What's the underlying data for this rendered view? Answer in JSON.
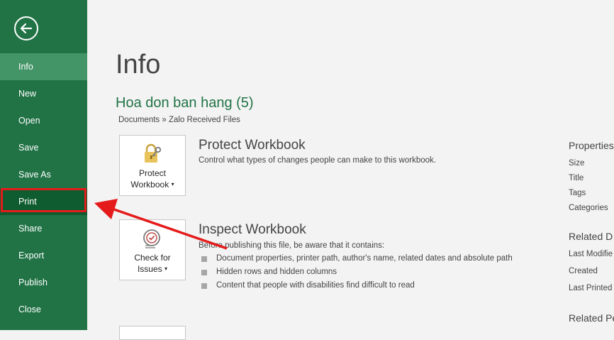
{
  "sidebar": {
    "items": [
      {
        "label": "Info"
      },
      {
        "label": "New"
      },
      {
        "label": "Open"
      },
      {
        "label": "Save"
      },
      {
        "label": "Save As"
      },
      {
        "label": "Print"
      },
      {
        "label": "Share"
      },
      {
        "label": "Export"
      },
      {
        "label": "Publish"
      },
      {
        "label": "Close"
      }
    ]
  },
  "main": {
    "title": "Info",
    "file_name": "Hoa don ban hang (5)",
    "breadcrumb": "Documents » Zalo Received Files",
    "protect": {
      "button_line1": "Protect",
      "button_line2": "Workbook",
      "title": "Protect Workbook",
      "description": "Control what types of changes people can make to this workbook."
    },
    "inspect": {
      "button_line1": "Check for",
      "button_line2": "Issues",
      "title": "Inspect Workbook",
      "description": "Before publishing this file, be aware that it contains:",
      "bullets": [
        "Document properties, printer path, author's name, related dates and absolute path",
        "Hidden rows and hidden columns",
        "Content that people with disabilities find difficult to read"
      ]
    }
  },
  "properties": {
    "title": "Properties",
    "items": [
      "Size",
      "Title",
      "Tags",
      "Categories"
    ],
    "related_dates_title": "Related D",
    "related_dates": [
      "Last Modifie",
      "Created",
      "Last Printed"
    ],
    "related_people_title": "Related Pe"
  },
  "colors": {
    "accent": "#217346",
    "highlight": "#e51b1b"
  }
}
